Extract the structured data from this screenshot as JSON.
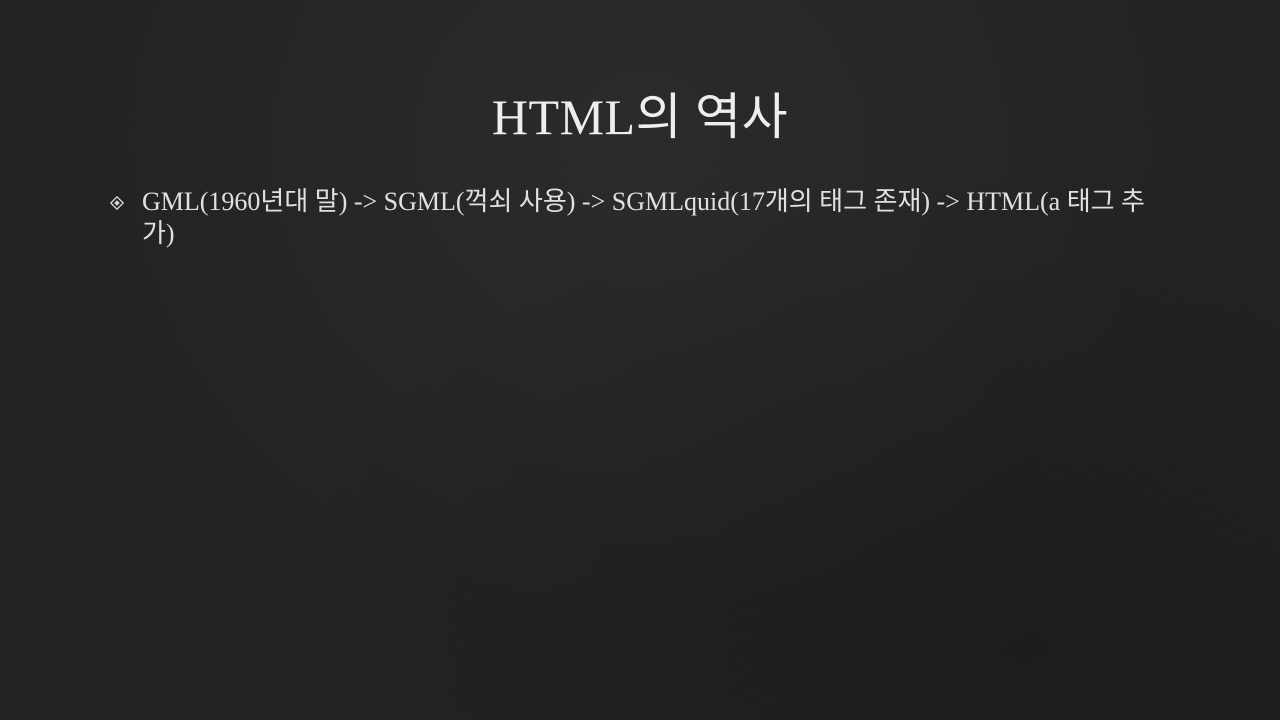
{
  "slide": {
    "title": "HTML의 역사",
    "bullets": [
      {
        "icon": "diamond-bullet-icon",
        "text": "GML(1960년대 말) -> SGML(꺽쇠 사용) -> SGMLquid(17개의 태그 존재) -> HTML(a 태그 추가)"
      }
    ]
  },
  "colors": {
    "background": "#232325",
    "title_text": "#eeeeee",
    "body_text": "#e0e0e0"
  }
}
